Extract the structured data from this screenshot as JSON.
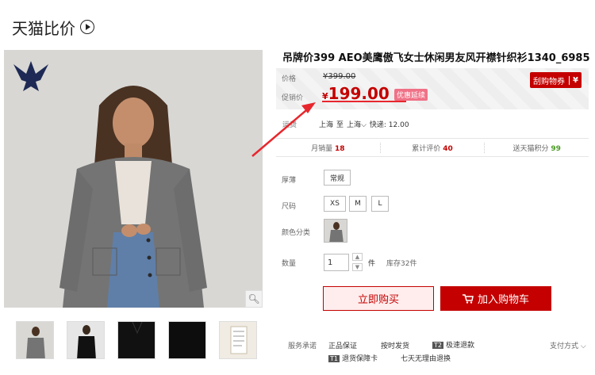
{
  "page": {
    "title": "天猫比价"
  },
  "product": {
    "title": "吊牌价399 AEO美鹰傲飞女士休闲男友风开襟针织衫1340_6985",
    "price": {
      "label_orig": "价格",
      "orig": "¥399.00",
      "label_promo": "促销价",
      "currency": "¥",
      "promo": "199.00",
      "promo_badge": "优惠延续"
    },
    "coupon": {
      "label": "刮购物券",
      "symbol": "¥"
    },
    "shipping": {
      "label": "运费",
      "from": "上海",
      "to_word": "至",
      "to": "上海",
      "express": "快递: 12.00"
    },
    "stats": {
      "monthly_label": "月销量",
      "monthly": "18",
      "reviews_label": "累计评价",
      "reviews": "40",
      "points_label": "送天猫积分",
      "points": "99"
    },
    "options": {
      "thickness_label": "厚薄",
      "thickness": "常规",
      "size_label": "尺码",
      "sizes": [
        "XS",
        "M",
        "L"
      ],
      "color_label": "颜色分类",
      "qty_label": "数量",
      "qty": "1",
      "qty_unit": "件",
      "stock": "库存32件"
    },
    "actions": {
      "buy_now": "立即购买",
      "add_cart": "加入购物车"
    },
    "service": {
      "label": "服务承诺",
      "items": [
        "正品保证",
        "按时发货",
        "极速退款",
        "退货保障卡",
        "七天无理由退换"
      ],
      "t2": "T2",
      "t1": "T1",
      "payment": "支付方式"
    }
  },
  "colors": {
    "accent": "#c40000",
    "annotation": "#e8262d"
  }
}
